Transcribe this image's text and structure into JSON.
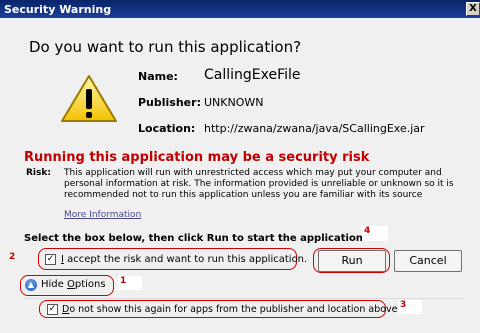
{
  "window": {
    "title": "Security Warning",
    "close_glyph": "X"
  },
  "dialog": {
    "question": "Do you want to run this application?",
    "name_label": "Name:",
    "name_value": "CallingExeFile",
    "publisher_label": "Publisher:",
    "publisher_value": "UNKNOWN",
    "location_label": "Location:",
    "location_value": "http://zwana/zwana/java/SCallingExe.jar",
    "risk_heading": "Running this application may be a security risk",
    "risk_label": "Risk:",
    "risk_text": "This application will run with unrestricted access which may put your computer and personal information at risk. The information provided is unreliable or unknown so it is recommended not to run this application unless you are familiar with its source",
    "more_info": "More Information",
    "select_instruction": "Select the box below, then click Run to start the application",
    "accept_label_u": "I",
    "accept_label_rest": " accept the risk and want to run this application.",
    "run_button": "Run",
    "cancel_button": "Cancel",
    "hide_options_prefix": "Hide ",
    "hide_options_u": "O",
    "hide_options_rest": "ptions",
    "dont_show_u": "D",
    "dont_show_rest": "o not show this again for apps from the publisher and location above"
  },
  "annotations": {
    "m1": "1",
    "m2": "2",
    "m3": "3",
    "m4": "4"
  },
  "colors": {
    "title_bar": "#0a246a",
    "risk_heading": "#c00000",
    "annotation_red": "#d00000"
  },
  "icons": {
    "warning": "warning-triangle-icon",
    "hide_options": "chevron-up-circle-icon"
  }
}
